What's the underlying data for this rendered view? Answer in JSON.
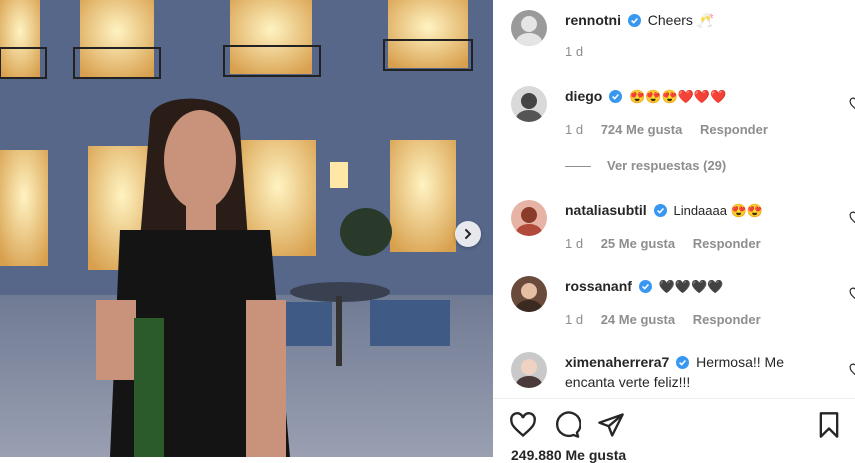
{
  "post": {
    "author": "rennotni",
    "caption": "Cheers 🥂",
    "time": "1 d",
    "likes": "249.880 Me gusta"
  },
  "comments": [
    {
      "user": "diego",
      "text": "😍😍😍❤️❤️❤️",
      "time": "1 d",
      "likes": "724 Me gusta",
      "reply": "Responder"
    },
    {
      "user": "nataliasubtil",
      "text": "Lindaaaa 😍😍",
      "time": "1 d",
      "likes": "25 Me gusta",
      "reply": "Responder"
    },
    {
      "user": "rossananf",
      "text": "🖤🖤🖤🖤",
      "time": "1 d",
      "likes": "24 Me gusta",
      "reply": "Responder"
    },
    {
      "user": "ximenaherrera7",
      "text": "Hermosa!! Me encanta verte feliz!!!",
      "time": "",
      "likes": "",
      "reply": ""
    }
  ],
  "view_replies": "Ver respuestas (29)",
  "icons": {
    "verified": "verified-badge-icon",
    "heart": "heart-outline-icon",
    "comment": "comment-icon",
    "share": "paper-plane-icon",
    "save": "bookmark-icon",
    "next": "chevron-right-icon"
  },
  "colors": {
    "verified": "#3897f0",
    "muted": "#8e8e8e",
    "text": "#262626"
  }
}
